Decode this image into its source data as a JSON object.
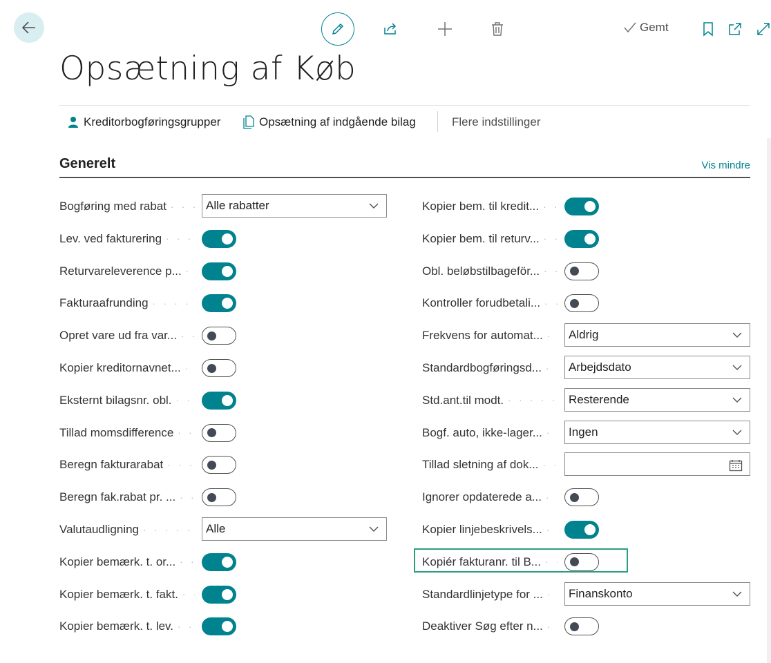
{
  "page": {
    "title": "Opsætning af Køb",
    "saved_label": "Gemt"
  },
  "actions": {
    "vendor_posting_groups": "Kreditorbogføringsgrupper",
    "incoming_docs_setup": "Opsætning af indgående bilag",
    "more_settings": "Flere indstillinger"
  },
  "section": {
    "title": "Generelt",
    "toggle_label": "Vis mindre"
  },
  "left_fields": [
    {
      "label": "Bogføring med rabat",
      "type": "select",
      "value": "Alle rabatter"
    },
    {
      "label": "Lev. ved fakturering",
      "type": "toggle",
      "on": true
    },
    {
      "label": "Returvareleverence p...",
      "type": "toggle",
      "on": true
    },
    {
      "label": "Fakturaafrunding",
      "type": "toggle",
      "on": true
    },
    {
      "label": "Opret vare ud fra var...",
      "type": "toggle",
      "on": false
    },
    {
      "label": "Kopier kreditornavnet...",
      "type": "toggle",
      "on": false
    },
    {
      "label": "Eksternt bilagsnr. obl.",
      "type": "toggle",
      "on": true
    },
    {
      "label": "Tillad momsdifference",
      "type": "toggle",
      "on": false
    },
    {
      "label": "Beregn fakturarabat",
      "type": "toggle",
      "on": false
    },
    {
      "label": "Beregn fak.rabat pr. ...",
      "type": "toggle",
      "on": false
    },
    {
      "label": "Valutaudligning",
      "type": "select",
      "value": "Alle"
    },
    {
      "label": "Kopier bemærk. t. or...",
      "type": "toggle",
      "on": true
    },
    {
      "label": "Kopier bemærk. t. fakt.",
      "type": "toggle",
      "on": true
    },
    {
      "label": "Kopier bemærk. t. lev.",
      "type": "toggle",
      "on": true
    }
  ],
  "right_fields": [
    {
      "label": "Kopier bem. til kredit...",
      "type": "toggle",
      "on": true
    },
    {
      "label": "Kopier bem. til returv...",
      "type": "toggle",
      "on": true
    },
    {
      "label": "Obl. beløbstilbageför...",
      "type": "toggle",
      "on": false
    },
    {
      "label": "Kontroller forudbetali...",
      "type": "toggle",
      "on": false
    },
    {
      "label": "Frekvens for automat...",
      "type": "select",
      "value": "Aldrig"
    },
    {
      "label": "Standardbogføringsd...",
      "type": "select",
      "value": "Arbejdsdato"
    },
    {
      "label": "Std.ant.til modt.",
      "type": "select",
      "value": "Resterende"
    },
    {
      "label": "Bogf. auto, ikke-lager...",
      "type": "select",
      "value": "Ingen"
    },
    {
      "label": "Tillad sletning af dok...",
      "type": "date",
      "value": ""
    },
    {
      "label": "Ignorer opdaterede a...",
      "type": "toggle",
      "on": false
    },
    {
      "label": "Kopier linjebeskrivels...",
      "type": "toggle",
      "on": true
    },
    {
      "label": "Kopiér fakturanr. til B...",
      "type": "toggle",
      "on": false
    },
    {
      "label": "Standardlinjetype for ...",
      "type": "select",
      "value": "Finanskonto"
    },
    {
      "label": "Deaktiver Søg efter n...",
      "type": "toggle",
      "on": false
    }
  ],
  "colors": {
    "accent": "#00838f",
    "highlight_border": "#2a9d7f"
  }
}
